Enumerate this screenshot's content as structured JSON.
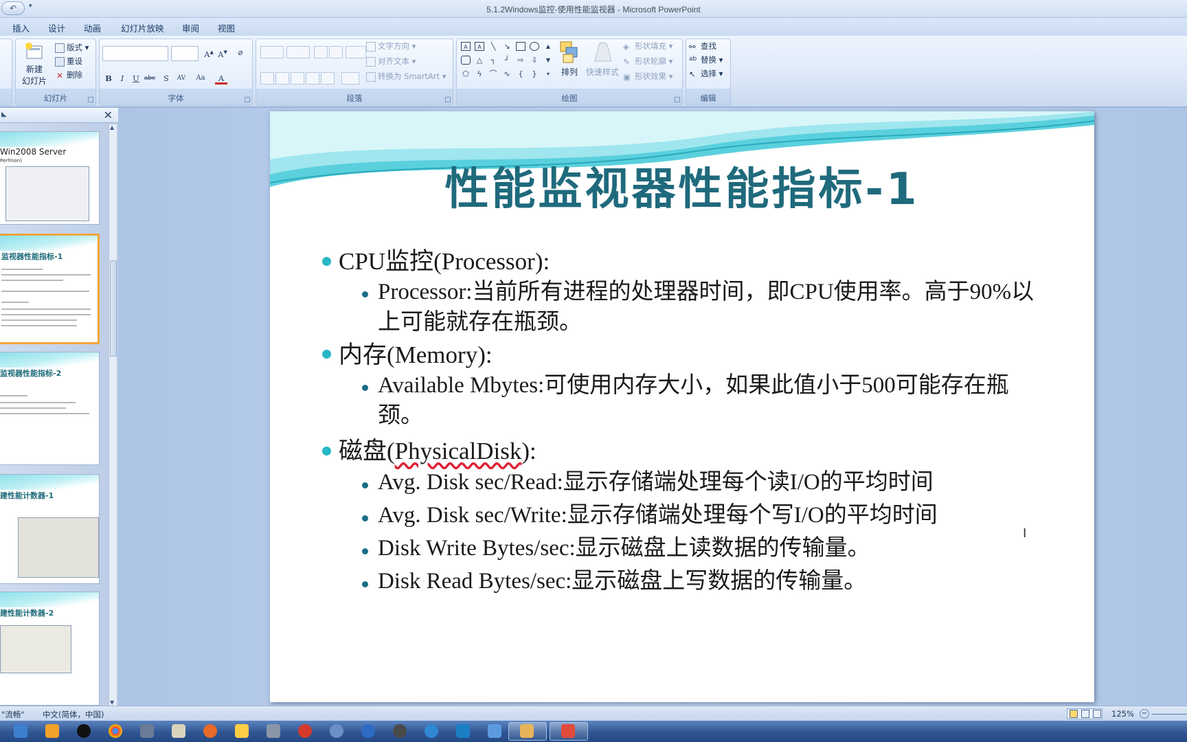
{
  "window": {
    "title": "5.1.2Windows监控-使用性能监视器 - Microsoft PowerPoint"
  },
  "ribbon": {
    "tabs": [
      "插入",
      "设计",
      "动画",
      "幻灯片放映",
      "审阅",
      "视图"
    ],
    "slides_group": {
      "label": "幻灯片",
      "new_slide_line1": "新建",
      "new_slide_line2": "幻灯片",
      "layout": "版式",
      "reset": "重设",
      "delete": "删除"
    },
    "font_group": {
      "label": "字体"
    },
    "paragraph_group": {
      "label": "段落",
      "text_direction": "文字方向",
      "align_text": "对齐文本",
      "convert_smartart": "转换为 SmartArt"
    },
    "drawing_group": {
      "label": "绘图",
      "arrange": "排列",
      "quick_styles": "快速样式",
      "shape_fill": "形状填充",
      "shape_outline": "形状轮廓",
      "shape_effects": "形状效果"
    },
    "editing_group": {
      "label": "编辑",
      "find": "查找",
      "replace": "替换",
      "select": "选择"
    }
  },
  "thumbnails": [
    {
      "title": "Win2008  Server",
      "subtitle": "Perfmon)"
    },
    {
      "title": "监视器性能指标-1"
    },
    {
      "title": "监视器性能指标-2"
    },
    {
      "title": "建性能计数器-1"
    },
    {
      "title": "建性能计数器-2"
    }
  ],
  "slide": {
    "title": "性能监视器性能指标-1",
    "items": [
      {
        "text": "CPU监控(Processor):",
        "sub": [
          "Processor:当前所有进程的处理器时间，即CPU使用率。高于90%以上可能就存在瓶颈。"
        ]
      },
      {
        "text_a": "内存(Memory):",
        "sub": [
          "Available Mbytes:可使用内存大小，如果此值小于500可能存在瓶颈。"
        ]
      },
      {
        "pre": "磁盘(",
        "word": "PhysicalDisk",
        "post": "):",
        "sub": [
          "Avg. Disk  sec/Read:显示存储端处理每个读I/O的平均时间",
          "Avg. Disk  sec/Write:显示存储端处理每个写I/O的平均时间",
          "Disk Write Bytes/sec:显示磁盘上读数据的传输量。",
          "Disk Read Bytes/sec:显示磁盘上写数据的传输量。"
        ]
      }
    ]
  },
  "status": {
    "theme": "\"流畅\"",
    "language": "中文(简体，中国)",
    "zoom": "125%"
  },
  "colors": {
    "accent": "#1f6a7c",
    "bullet_primary": "#28b7c6",
    "selected_thumb": "#f3a53a"
  }
}
